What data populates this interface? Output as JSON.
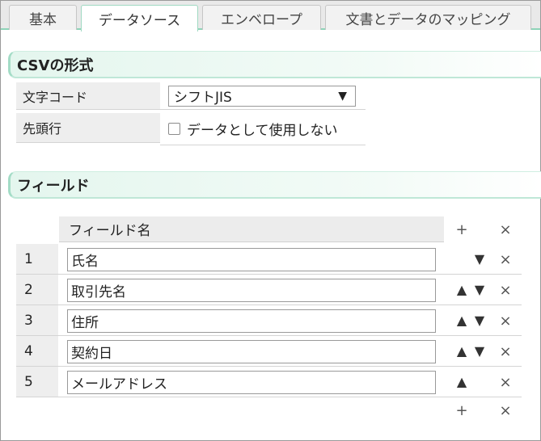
{
  "tabs": [
    {
      "label": "基本"
    },
    {
      "label": "データソース"
    },
    {
      "label": "エンベロープ"
    },
    {
      "label": "文書とデータのマッピング"
    }
  ],
  "csv_section": {
    "title": "CSVの形式",
    "encoding_label": "文字コード",
    "encoding_value": "シフトJIS",
    "encoding_arrow": "▼",
    "header_row_label": "先頭行",
    "header_row_checkbox_label": "データとして使用しない"
  },
  "fields_section": {
    "title": "フィールド",
    "column_header": "フィールド名",
    "add_symbol": "+",
    "delete_symbol": "×",
    "up_symbol": "▲",
    "down_symbol": "▼",
    "rows": [
      {
        "num": "1",
        "value": "氏名"
      },
      {
        "num": "2",
        "value": "取引先名"
      },
      {
        "num": "3",
        "value": "住所"
      },
      {
        "num": "4",
        "value": "契約日"
      },
      {
        "num": "5",
        "value": "メールアドレス"
      }
    ]
  },
  "colors": {
    "accent": "#8ed3b8",
    "section_bg": "#e4f6ee"
  }
}
